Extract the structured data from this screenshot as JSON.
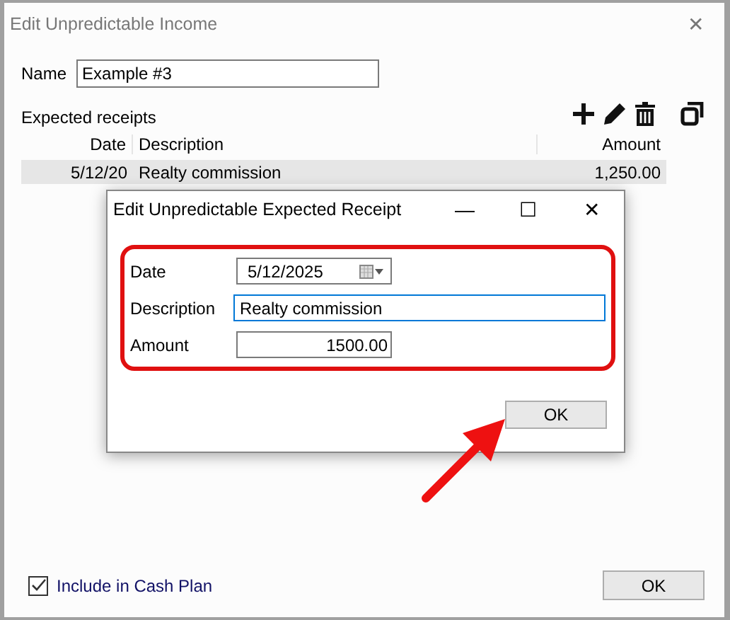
{
  "window": {
    "title": "Edit Unpredictable Income",
    "close": "✕"
  },
  "name_field": {
    "label": "Name",
    "value": "Example #3"
  },
  "receipts": {
    "label": "Expected receipts",
    "columns": [
      "Date",
      "Description",
      "Amount"
    ],
    "rows": [
      {
        "date": "5/12/20",
        "description": "Realty commission",
        "amount": "1,250.00",
        "selected": true
      }
    ]
  },
  "dialog": {
    "title": "Edit Unpredictable Expected Receipt",
    "minimize": "—",
    "maximize": "☐",
    "close": "✕",
    "fields": [
      {
        "kind": "date",
        "label": "Date",
        "value": "5/12/2025"
      },
      {
        "kind": "text",
        "label": "Description",
        "value": "Realty commission",
        "focused": true
      },
      {
        "kind": "number",
        "label": "Amount",
        "value": "1500.00"
      }
    ],
    "ok": "OK"
  },
  "include_checkbox": {
    "label": "Include in Cash Plan",
    "checked": true
  },
  "ok_button": "OK"
}
